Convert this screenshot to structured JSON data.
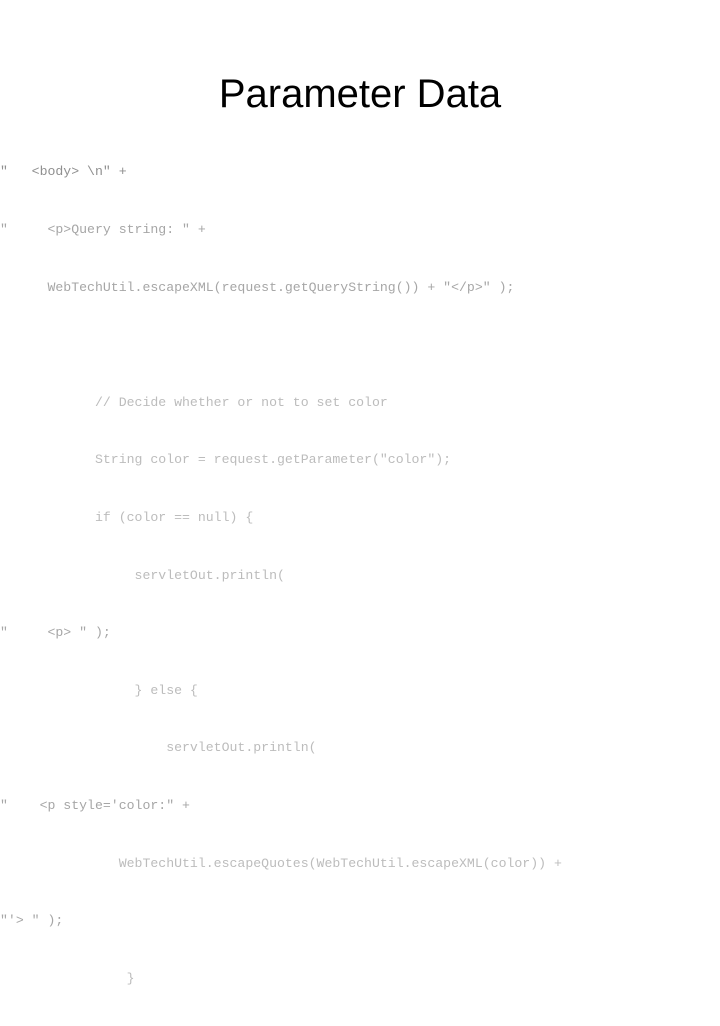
{
  "slide": {
    "title": "Parameter Data",
    "text_color": "#000000",
    "background_color": "#ffffff",
    "code_color": "#b3b3b3"
  },
  "code": {
    "lines": [
      {
        "text": "\"   <body> \\n\" +",
        "tone": "dark"
      },
      {
        "text": "\"     <p>Query string: \" +",
        "tone": "mid"
      },
      {
        "text": "      WebTechUtil.escapeXML(request.getQueryString()) + \"</p>\" );",
        "tone": "mid"
      },
      {
        "text": "",
        "tone": "blank"
      },
      {
        "text": "            // Decide whether or not to set color",
        "tone": "light"
      },
      {
        "text": "            String color = request.getParameter(\"color\");",
        "tone": "light"
      },
      {
        "text": "            if (color == null) {",
        "tone": "light"
      },
      {
        "text": "                 servletOut.println(",
        "tone": "light"
      },
      {
        "text": "\"     <p> \" );",
        "tone": "mid"
      },
      {
        "text": "                 } else {",
        "tone": "light"
      },
      {
        "text": "                     servletOut.println(",
        "tone": "light"
      },
      {
        "text": "\"    <p style='color:\" +",
        "tone": "mid"
      },
      {
        "text": "               WebTechUtil.escapeQuotes(WebTechUtil.escapeXML(color)) +",
        "tone": "light"
      },
      {
        "text": "\"'> \" );",
        "tone": "mid"
      },
      {
        "text": "                }",
        "tone": "light"
      }
    ]
  }
}
